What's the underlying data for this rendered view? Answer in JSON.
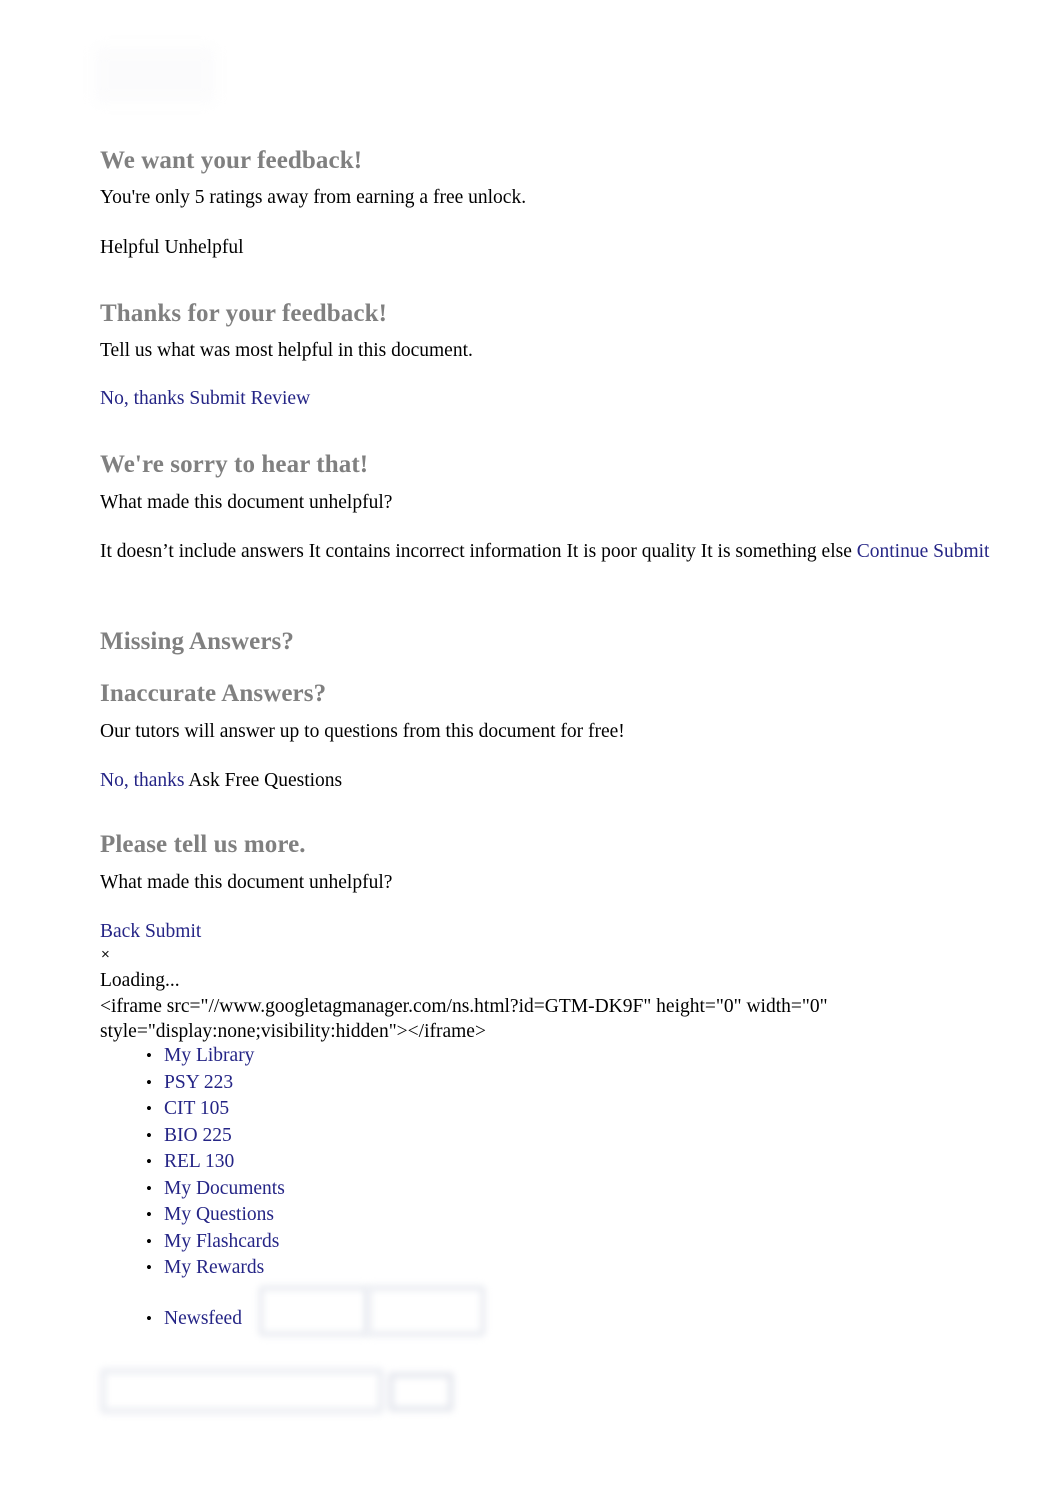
{
  "page": {
    "background": "#ffffff",
    "heading_color": "#808080",
    "link_color": "#252586",
    "text_color": "#000000"
  },
  "logo": {
    "name": "site-logo-placeholder"
  },
  "feedback_prompt": {
    "heading": "We want your feedback!",
    "body": "You're only 5 ratings away from earning a free unlock.",
    "helpful_label": "Helpful",
    "unhelpful_label": "Unhelpful",
    "actions_line": "Helpful Unhelpful"
  },
  "thanks_panel": {
    "heading": "Thanks for your feedback!",
    "body": "Tell us what was most helpful in this document.",
    "no_thanks_label": "No, thanks",
    "submit_review_label": "Submit Review",
    "actions_line": "No, thanks Submit Review"
  },
  "sorry_panel": {
    "heading": "We're sorry to hear that!",
    "question": "What made this document unhelpful?",
    "options": [
      "It doesn’t include answers",
      "It contains incorrect information",
      "It is poor quality",
      "It is something else"
    ],
    "options_line": "It doesn’t include answers It contains incorrect information It is poor quality It is something else",
    "continue_label": "Continue",
    "submit_label": "Submit",
    "actions_line": "Continue Submit"
  },
  "missing_answers": {
    "heading": "Missing Answers?"
  },
  "inaccurate_answers": {
    "heading": "Inaccurate Answers?",
    "body": "Our tutors will answer up to questions from this document for free!",
    "no_thanks_label": "No, thanks",
    "ask_free_questions_label": "Ask Free Questions"
  },
  "tell_us_more": {
    "heading": "Please tell us more.",
    "question": "What made this document unhelpful?",
    "back_label": "Back",
    "submit_label": "Submit",
    "actions_line": "Back Submit"
  },
  "modal": {
    "close_label": "×",
    "loading_label": "Loading..."
  },
  "noscript_snippet": {
    "line1": "<iframe src=\"//www.googletagmanager.com/ns.html?id=GTM-DK9F\" height=\"0\" width=\"0\"",
    "line2": "style=\"display:none;visibility:hidden\"></iframe>"
  },
  "nav": {
    "items": [
      {
        "label": "My Library"
      },
      {
        "label": "PSY 223"
      },
      {
        "label": "CIT 105"
      },
      {
        "label": "BIO 225"
      },
      {
        "label": "REL 130"
      },
      {
        "label": "My Documents"
      },
      {
        "label": "My Questions"
      },
      {
        "label": "My Flashcards"
      },
      {
        "label": "My Rewards"
      }
    ],
    "newsfeed_label": "Newsfeed"
  },
  "search": {
    "placeholder": "",
    "value": ""
  }
}
